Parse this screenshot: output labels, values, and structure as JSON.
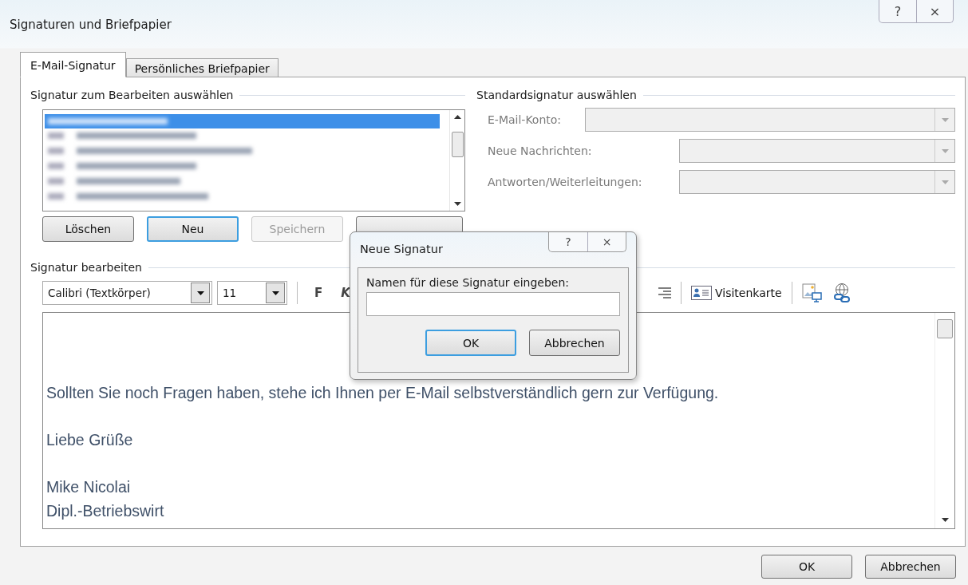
{
  "window": {
    "title": "Signaturen und Briefpapier",
    "help": "?",
    "close": "×"
  },
  "tabs": [
    {
      "label": "E-Mail-Signatur",
      "selected": true
    },
    {
      "label": "Persönliches Briefpapier",
      "selected": false
    }
  ],
  "select_group": {
    "title": "Signatur zum Bearbeiten auswählen",
    "buttons": [
      {
        "label": "Löschen",
        "disabled": false,
        "default": false
      },
      {
        "label": "Neu",
        "disabled": false,
        "default": true
      },
      {
        "label": "Speichern",
        "disabled": true,
        "default": false
      },
      {
        "disabled": false,
        "default": false
      }
    ]
  },
  "default_group": {
    "title": "Standardsignatur auswählen",
    "fields": [
      {
        "label": "E-Mail-Konto:",
        "disabled": true,
        "wide": true
      },
      {
        "label": "Neue Nachrichten:",
        "disabled": true,
        "wide": false
      },
      {
        "label": "Antworten/Weiterleitungen:",
        "disabled": true,
        "wide": false
      }
    ]
  },
  "edit_group": {
    "title": "Signatur bearbeiten",
    "font": "Calibri (Textkörper)",
    "size": "11",
    "bold": "F",
    "italic": "K",
    "business_card": {
      "label": "Visitenkarte"
    },
    "body": [
      {
        "lines": [
          "Sollten Sie noch Fragen haben, stehe ich Ihnen per E-Mail selbstverständlich gern zur Verfügung."
        ]
      },
      {
        "lines": [
          "Liebe Grüße"
        ]
      },
      {
        "lines": [
          "Mike Nicolai",
          "Dipl.-Betriebswirt"
        ]
      }
    ]
  },
  "buttons": [
    {
      "label": "OK"
    },
    {
      "label": "Abbrechen"
    }
  ],
  "new_dialog": {
    "title": "Neue Signatur",
    "help": "?",
    "close": "×",
    "prompt": "Namen für diese Signatur eingeben:",
    "buttons": [
      {
        "label": "OK",
        "default": true
      },
      {
        "label": "Abbrechen",
        "default": false
      }
    ]
  }
}
